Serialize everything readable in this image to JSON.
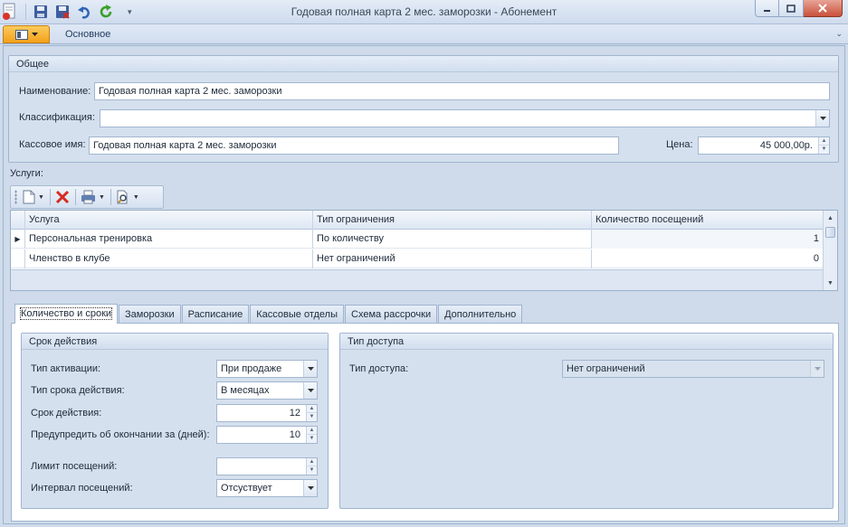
{
  "window": {
    "title": "Годовая полная карта 2 мес. заморозки - Абонемент"
  },
  "ribbon": {
    "tab": "Основное"
  },
  "general": {
    "header": "Общее",
    "name_label": "Наименование:",
    "name_value": "Годовая полная карта 2 мес. заморозки",
    "classification_label": "Классификация:",
    "classification_value": "",
    "cash_name_label": "Кассовое имя:",
    "cash_name_value": "Годовая полная карта 2 мес. заморозки",
    "price_label": "Цена:",
    "price_value": "45 000,00р."
  },
  "services": {
    "label": "Услуги:",
    "columns": [
      "Услуга",
      "Тип ограничения",
      "Количество посещений"
    ],
    "rows": [
      {
        "service": "Персональная тренировка",
        "limit_type": "По количеству",
        "visits": "1"
      },
      {
        "service": "Членство в клубе",
        "limit_type": "Нет ограничений",
        "visits": "0"
      }
    ]
  },
  "tabs": [
    "Количество и сроки",
    "Заморозки",
    "Расписание",
    "Кассовые отделы",
    "Схема рассрочки",
    "Дополнительно"
  ],
  "validity": {
    "header": "Срок действия",
    "activation_type_label": "Тип активации:",
    "activation_type_value": "При продаже",
    "term_type_label": "Тип срока действия:",
    "term_type_value": "В месяцах",
    "term_label": "Срок действия:",
    "term_value": "12",
    "warn_label": "Предупредить об окончании за (дней):",
    "warn_value": "10",
    "visit_limit_label": "Лимит посещений:",
    "visit_limit_value": "",
    "visit_interval_label": "Интервал посещений:",
    "visit_interval_value": "Отсуствует"
  },
  "access": {
    "header": "Тип доступа",
    "access_type_label": "Тип доступа:",
    "access_type_value": "Нет ограничений"
  },
  "colors": {
    "app_button": "#f3a01a",
    "delete_icon": "#d62b1f",
    "refresh_icon": "#3aa02a",
    "undo_icon": "#2f64b4"
  }
}
